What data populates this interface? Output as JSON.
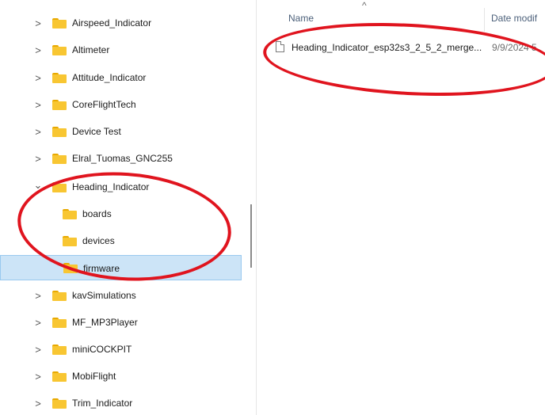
{
  "nav": {
    "items": [
      {
        "label": "Airspeed_Indicator",
        "expand": ">"
      },
      {
        "label": "Altimeter",
        "expand": ">"
      },
      {
        "label": "Attitude_Indicator",
        "expand": ">"
      },
      {
        "label": "CoreFlightTech",
        "expand": ">"
      },
      {
        "label": "Device Test",
        "expand": ">"
      },
      {
        "label": "Elral_Tuomas_GNC255",
        "expand": ">"
      },
      {
        "label": "Heading_Indicator",
        "expand": "⌄"
      },
      {
        "label": "boards",
        "expand": ""
      },
      {
        "label": "devices",
        "expand": ""
      },
      {
        "label": "firmware",
        "expand": ""
      },
      {
        "label": "kavSimulations",
        "expand": ">"
      },
      {
        "label": "MF_MP3Player",
        "expand": ">"
      },
      {
        "label": "miniCOCKPIT",
        "expand": ">"
      },
      {
        "label": "MobiFlight",
        "expand": ">"
      },
      {
        "label": "Trim_Indicator",
        "expand": ">"
      }
    ],
    "selected_index": 9
  },
  "content": {
    "columns": {
      "name": "Name",
      "sort_indicator": "^",
      "date": "Date modif"
    },
    "files": [
      {
        "name": "Heading_Indicator_esp32s3_2_5_2_merge...",
        "date": "9/9/2024 5"
      }
    ]
  },
  "icons": {
    "folder": "folder-icon",
    "file": "file-icon",
    "chevron": "chevron-right-icon",
    "chevron_expanded": "chevron-down-icon"
  },
  "colors": {
    "annotation": "#e0141e",
    "selection": "#cce4f7",
    "folder": "#f8c632"
  }
}
